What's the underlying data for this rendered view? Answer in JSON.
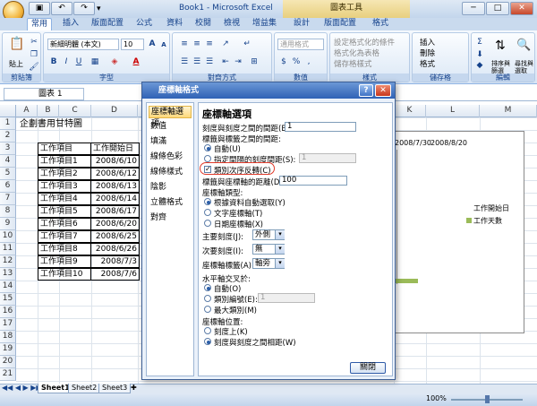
{
  "window": {
    "title": "Book1 - Microsoft Excel",
    "context_tab_label": "圖表工具"
  },
  "quick_access": {
    "undo": "↶",
    "redo": "↷",
    "save": "▣",
    "more": "▾"
  },
  "window_controls": {
    "minimize": "─",
    "maximize": "□",
    "close": "✕"
  },
  "tabs": [
    "常用",
    "插入",
    "版面配置",
    "公式",
    "資料",
    "校閱",
    "檢視",
    "增益集",
    "設計",
    "版面配置",
    "格式"
  ],
  "ribbon": {
    "clipboard": {
      "label": "剪貼簿",
      "paste": "貼上"
    },
    "font": {
      "label": "字型",
      "name": "新細明體 (本文)",
      "size": "10",
      "bold": "B",
      "italic": "I",
      "underline": "U",
      "grow": "A",
      "shrink": "A",
      "color_a": "A"
    },
    "alignment": {
      "label": "對齊方式"
    },
    "number": {
      "label": "數值",
      "format": "通用格式",
      "dollar": "$",
      "percent": "%",
      "comma": ","
    },
    "styles": {
      "label": "樣式",
      "conditional": "設定格式化的條件",
      "as_table": "格式化為表格",
      "cell_styles": "儲存格樣式"
    },
    "cells": {
      "label": "儲存格",
      "insert": "插入",
      "delete": "刪除",
      "format": "格式"
    },
    "editing": {
      "label": "編輯",
      "sum": "Σ",
      "sort": "排序與篩選",
      "find": "尋找與選取"
    }
  },
  "formula_bar": {
    "name_box": "圖表 1"
  },
  "columns": [
    "A",
    "B",
    "C",
    "D",
    "",
    "",
    "",
    "",
    "",
    "",
    "",
    "K",
    "L",
    "M"
  ],
  "rows": [
    "1",
    "2",
    "3",
    "4",
    "5",
    "6",
    "7",
    "8",
    "9",
    "10",
    "11",
    "12",
    "13",
    "14",
    "15",
    "16",
    "17",
    "18",
    "19",
    "20",
    "21"
  ],
  "sheet": {
    "title": "企劃書用甘特圖",
    "headers": [
      "工作項目",
      "工作開始日"
    ],
    "tasks": [
      {
        "name": "工作項目1",
        "date": "2008/6/10"
      },
      {
        "name": "工作項目2",
        "date": "2008/6/12"
      },
      {
        "name": "工作項目3",
        "date": "2008/6/13"
      },
      {
        "name": "工作項目4",
        "date": "2008/6/14"
      },
      {
        "name": "工作項目5",
        "date": "2008/6/17"
      },
      {
        "name": "工作項目6",
        "date": "2008/6/20"
      },
      {
        "name": "工作項目7",
        "date": "2008/6/25"
      },
      {
        "name": "工作項目8",
        "date": "2008/6/26"
      },
      {
        "name": "工作項目9",
        "date": "2008/7/3"
      },
      {
        "name": "工作項目10",
        "date": "2008/7/6"
      }
    ]
  },
  "chart": {
    "axis_labels": [
      "2008/7/30",
      "2008/8/20"
    ],
    "legend": [
      {
        "label": "工作開始日",
        "color": "#ffffff"
      },
      {
        "label": "工作天數",
        "color": "#9bbb59"
      }
    ]
  },
  "sheet_tabs": [
    "Sheet1",
    "Sheet2",
    "Sheet3"
  ],
  "status": {
    "zoom": "100%"
  },
  "dialog": {
    "title": "座標軸格式",
    "help": "?",
    "close": "✕",
    "nav": [
      "座標軸選項",
      "數值",
      "填滿",
      "線條色彩",
      "線條樣式",
      "陰影",
      "立體格式",
      "對齊"
    ],
    "panel_title": "座標軸選項",
    "interval_between_ticks": {
      "label": "刻度與刻度之間的間距(B):",
      "value": "1"
    },
    "interval_between_labels": {
      "label": "標籤與標籤之間的間距:",
      "auto": "自動(U)",
      "specify": "指定間隔的刻度間距(S):",
      "specify_value": "1"
    },
    "reverse_order": {
      "label": "類別次序反轉(C)",
      "checked": "✓"
    },
    "label_distance": {
      "label": "標籤與座標軸的距離(D):",
      "value": "100"
    },
    "axis_type": {
      "label": "座標軸類型:",
      "auto": "根據資料自動選取(Y)",
      "text": "文字座標軸(T)",
      "date": "日期座標軸(X)"
    },
    "major_tick": {
      "label": "主要刻度(J):",
      "value": "外側"
    },
    "minor_tick": {
      "label": "次要刻度(I):",
      "value": "無"
    },
    "axis_labels": {
      "label": "座標軸標籤(A):",
      "value": "軸旁"
    },
    "crosses": {
      "label": "水平軸交叉於:",
      "auto": "自動(O)",
      "at_category": "類別編號(E):",
      "at_category_value": "1",
      "max": "最大類別(M)"
    },
    "position": {
      "label": "座標軸位置:",
      "on_ticks": "刻度上(K)",
      "between": "刻度與刻度之間相距(W)"
    },
    "dropdown_arrow": "▾",
    "close_button": "關閉"
  }
}
